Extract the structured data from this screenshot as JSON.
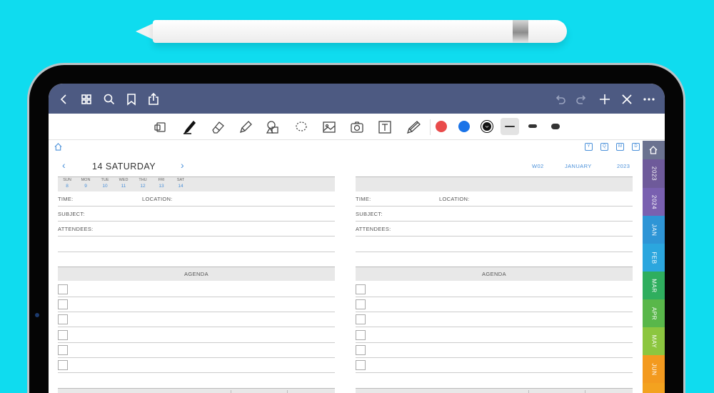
{
  "toolbar_top": {
    "left_icons": [
      "back-icon",
      "grid-icon",
      "search-icon",
      "bookmark-icon",
      "share-icon"
    ],
    "right_icons": [
      "undo-icon",
      "redo-icon",
      "add-icon",
      "close-icon",
      "more-icon"
    ]
  },
  "tools": {
    "icons": [
      "read-only-icon",
      "pen-icon",
      "eraser-icon",
      "highlighter-icon",
      "shapes-icon",
      "lasso-icon",
      "image-icon",
      "camera-icon",
      "text-icon",
      "element-icon"
    ],
    "colors": [
      "#e94b4b",
      "#1a73e8",
      "#111111"
    ],
    "stroke_sizes": [
      "thin",
      "medium",
      "thick"
    ]
  },
  "page": {
    "mini_tabs": [
      "Y",
      "Q",
      "M",
      "D"
    ],
    "date_title": "14 SATURDAY",
    "week_label": "W02",
    "month_label": "JANUARY",
    "year_label": "2023",
    "week_days": [
      {
        "name": "SUN",
        "num": "8"
      },
      {
        "name": "MON",
        "num": "9"
      },
      {
        "name": "TUE",
        "num": "10"
      },
      {
        "name": "WED",
        "num": "11"
      },
      {
        "name": "THU",
        "num": "12"
      },
      {
        "name": "FRI",
        "num": "13"
      },
      {
        "name": "SAT",
        "num": "14"
      }
    ],
    "labels": {
      "time": "TIME:",
      "location": "LOCATION:",
      "subject": "SUBJECT:",
      "attendees": "ATTENDEES:",
      "agenda": "AGENDA"
    }
  },
  "side_tabs": [
    {
      "label": "",
      "color": "#6b7290",
      "icon": "home-icon"
    },
    {
      "label": "2023",
      "color": "#6e5a9a"
    },
    {
      "label": "2024",
      "color": "#7960b0"
    },
    {
      "label": "JAN",
      "color": "#2e95d6"
    },
    {
      "label": "FEB",
      "color": "#2ba6de"
    },
    {
      "label": "MAR",
      "color": "#2fae5e"
    },
    {
      "label": "APR",
      "color": "#59b74a"
    },
    {
      "label": "MAY",
      "color": "#8cc63f"
    },
    {
      "label": "JUN",
      "color": "#f39a1f"
    },
    {
      "label": "",
      "color": "#f3a21f"
    }
  ]
}
